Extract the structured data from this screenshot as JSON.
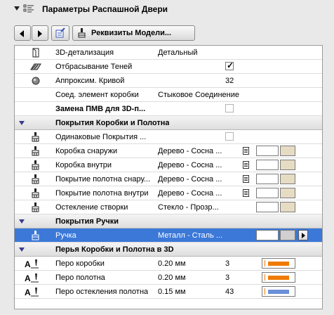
{
  "header": {
    "title": "Параметры Распашной Двери"
  },
  "toolbar": {
    "model_attributes_label": "Реквизиты Модели..."
  },
  "rows": [
    {
      "kind": "item",
      "icon": "3d-detail-icon",
      "name": "3D-детализация",
      "value": "Детальный"
    },
    {
      "kind": "item",
      "icon": "shadow-icon",
      "name": "Отбрасывание Теней",
      "checked": true
    },
    {
      "kind": "item",
      "icon": "sphere-icon",
      "name": "Аппроксим. Кривой",
      "value": "32"
    },
    {
      "kind": "item",
      "icon": "none",
      "name": "Соед. элемент коробки",
      "value": "Стыковое Соединение"
    },
    {
      "kind": "item-bold",
      "icon": "none",
      "name": "Замена ПМВ для 3D-п...",
      "checked": false
    },
    {
      "kind": "group",
      "name": "Покрытия Коробки и Полотна"
    },
    {
      "kind": "item",
      "icon": "brush-icon",
      "name": "Одинаковые Покрытия ...",
      "checked": false
    },
    {
      "kind": "surface",
      "name": "Коробка снаружи",
      "value": "Дерево - Сосна ...",
      "doc": true
    },
    {
      "kind": "surface",
      "name": "Коробка внутри",
      "value": "Дерево - Сосна ...",
      "doc": true
    },
    {
      "kind": "surface",
      "name": "Покрытие полотна снару...",
      "value": "Дерево - Сосна ...",
      "doc": true
    },
    {
      "kind": "surface",
      "name": "Покрытие полотна внутри",
      "value": "Дерево - Сосна ...",
      "doc": true
    },
    {
      "kind": "surface",
      "name": "Остекление створки",
      "value": "Стекло - Прозр...",
      "doc": false
    },
    {
      "kind": "group",
      "name": "Покрытия Ручки"
    },
    {
      "kind": "selected",
      "name": "Ручка",
      "value": "Металл - Сталь ..."
    },
    {
      "kind": "group",
      "name": "Перья Коробки и Полотна в 3D"
    },
    {
      "kind": "pen",
      "name": "Перо коробки",
      "value": "0.20 мм",
      "num": "3",
      "color": "#ef7b00"
    },
    {
      "kind": "pen",
      "name": "Перо полотна",
      "value": "0.20 мм",
      "num": "3",
      "color": "#ef7b00"
    },
    {
      "kind": "pen",
      "name": "Перо остекления полотна",
      "value": "0.15 мм",
      "num": "43",
      "color": "#6a8fd8"
    }
  ],
  "colors": {
    "selection": "#3b78d8",
    "surface_swatch": "#e6dcc4"
  }
}
